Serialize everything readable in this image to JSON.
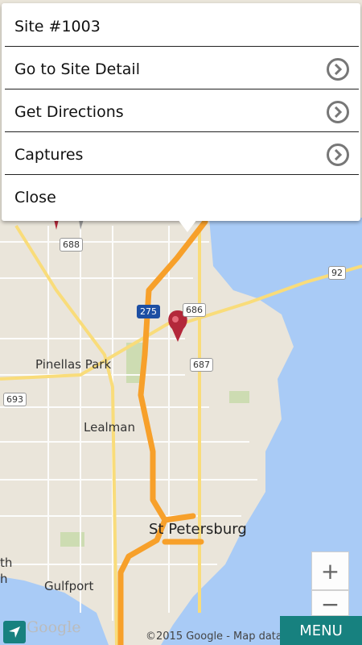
{
  "popup": {
    "title": "Site #1003",
    "items": [
      {
        "label": "Go to Site Detail"
      },
      {
        "label": "Get Directions"
      },
      {
        "label": "Captures"
      }
    ],
    "close_label": "Close"
  },
  "map": {
    "places": {
      "pinellas_park": "Pinellas Park",
      "lealman": "Lealman",
      "st_petersburg": "St Petersburg",
      "gulfport": "Gulfport",
      "th": "th",
      "h": "h"
    },
    "shields": {
      "r688": "688",
      "r686": "686",
      "r687": "687",
      "r693": "693",
      "i275": "275",
      "r92": "92"
    },
    "zoom_in": "+",
    "zoom_out": "−",
    "google_logo": "Google",
    "attribution": "©2015 Google - Map data",
    "colors": {
      "water": "#a9cbf6",
      "land": "#eae5da",
      "highway": "#f7a02a",
      "accent": "#17817f",
      "marker": "#b3283a"
    }
  },
  "menu_label": "MENU"
}
